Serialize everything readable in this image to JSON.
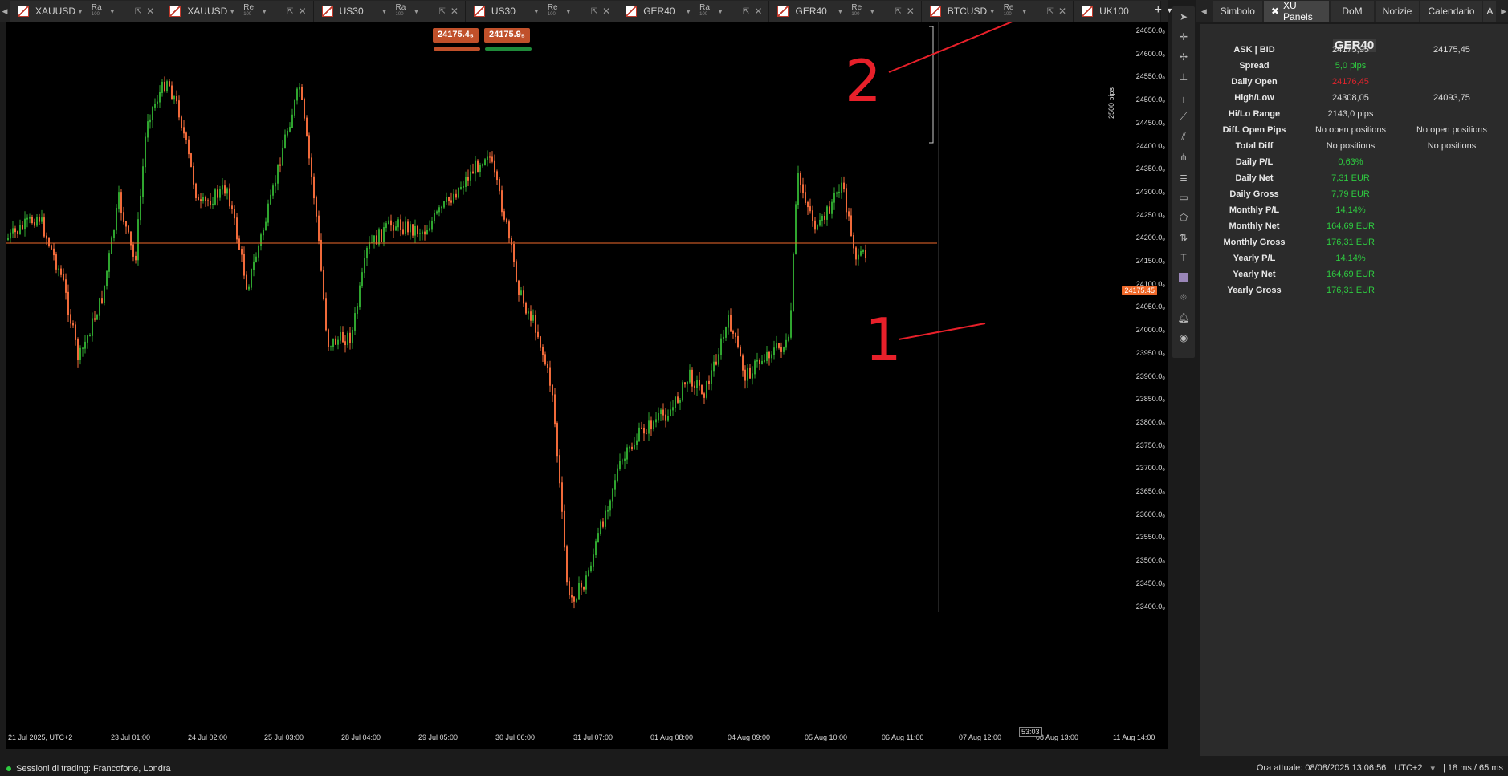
{
  "tabs": [
    {
      "symbol": "XAUUSD",
      "tf": "Ra",
      "tf_sub": "100"
    },
    {
      "symbol": "XAUUSD",
      "tf": "Re",
      "tf_sub": "100"
    },
    {
      "symbol": "US30",
      "tf": "Ra",
      "tf_sub": "100"
    },
    {
      "symbol": "US30",
      "tf": "Re",
      "tf_sub": "100"
    },
    {
      "symbol": "GER40",
      "tf": "Ra",
      "tf_sub": "100"
    },
    {
      "symbol": "GER40",
      "tf": "Re",
      "tf_sub": "100"
    },
    {
      "symbol": "BTCUSD",
      "tf": "Re",
      "tf_sub": "100"
    },
    {
      "symbol": "UK100",
      "tf": "",
      "tf_sub": ""
    }
  ],
  "chart": {
    "sell_price": "24175.4₅",
    "buy_price": "24175.9₅",
    "current_price_label": "24175.45",
    "pips_label": "2500 pips",
    "countdown": "53:03",
    "price_labels": [
      "24650.0₀",
      "24600.0₀",
      "24550.0₀",
      "24500.0₀",
      "24450.0₀",
      "24400.0₀",
      "24350.0₀",
      "24300.0₀",
      "24250.0₀",
      "24200.0₀",
      "24150.0₀",
      "24100.0₀",
      "24050.0₀",
      "24000.0₀",
      "23950.0₀",
      "23900.0₀",
      "23850.0₀",
      "23800.0₀",
      "23750.0₀",
      "23700.0₀",
      "23650.0₀",
      "23600.0₀",
      "23550.0₀",
      "23500.0₀",
      "23450.0₀",
      "23400.0₀"
    ],
    "time_labels": [
      "21 Jul 2025, UTC+2",
      "23 Jul 01:00",
      "24 Jul 02:00",
      "25 Jul 03:00",
      "28 Jul 04:00",
      "29 Jul 05:00",
      "30 Jul 06:00",
      "31 Jul 07:00",
      "01 Aug 08:00",
      "04 Aug 09:00",
      "05 Aug 10:00",
      "06 Aug 11:00",
      "07 Aug 12:00",
      "08 Aug 13:00",
      "11 Aug 14:00"
    ],
    "annotations": [
      "2",
      "1"
    ],
    "colors": {
      "bull": "#2fa52f",
      "bear": "#f06a3a",
      "price_line": "#f06a2b"
    }
  },
  "right_tabs": [
    "Simbolo",
    "XU Panels",
    "DoM",
    "Notizie",
    "Calendario",
    "A"
  ],
  "panel": {
    "title": "GER40",
    "rows": [
      {
        "label": "ASK | BID",
        "v1": "24175,95",
        "v2": "24175,45",
        "c1": "white"
      },
      {
        "label": "Spread",
        "v1": "5,0 pips",
        "v2": "",
        "c1": "green"
      },
      {
        "label": "Daily Open",
        "v1": "24176,45",
        "v2": "",
        "c1": "red"
      },
      {
        "label": "High/Low",
        "v1": "24308,05",
        "v2": "24093,75",
        "c1": "white"
      },
      {
        "label": "Hi/Lo Range",
        "v1": "2143,0 pips",
        "v2": "",
        "c1": "white"
      },
      {
        "label": "Diff. Open Pips",
        "v1": "No open positions",
        "v2": "No open positions",
        "c1": "white"
      },
      {
        "label": "Total Diff",
        "v1": "No positions",
        "v2": "No positions",
        "c1": "white"
      },
      {
        "label": "Daily P/L",
        "v1": "0,63%",
        "v2": "",
        "c1": "green"
      },
      {
        "label": "Daily Net",
        "v1": "7,31 EUR",
        "v2": "",
        "c1": "green"
      },
      {
        "label": "Daily Gross",
        "v1": "7,79 EUR",
        "v2": "",
        "c1": "green"
      },
      {
        "label": "Monthly P/L",
        "v1": "14,14%",
        "v2": "",
        "c1": "green"
      },
      {
        "label": "Monthly Net",
        "v1": "164,69 EUR",
        "v2": "",
        "c1": "green"
      },
      {
        "label": "Monthly Gross",
        "v1": "176,31 EUR",
        "v2": "",
        "c1": "green"
      },
      {
        "label": "Yearly P/L",
        "v1": "14,14%",
        "v2": "",
        "c1": "green"
      },
      {
        "label": "Yearly Net",
        "v1": "164,69 EUR",
        "v2": "",
        "c1": "green"
      },
      {
        "label": "Yearly Gross",
        "v1": "176,31 EUR",
        "v2": "",
        "c1": "green"
      }
    ]
  },
  "status": {
    "sessions": "Sessioni di trading: Francoforte, Londra",
    "time": "Ora attuale:  08/08/2025 13:06:56",
    "tz": "UTC+2",
    "latency": "| 18 ms / 65 ms"
  }
}
